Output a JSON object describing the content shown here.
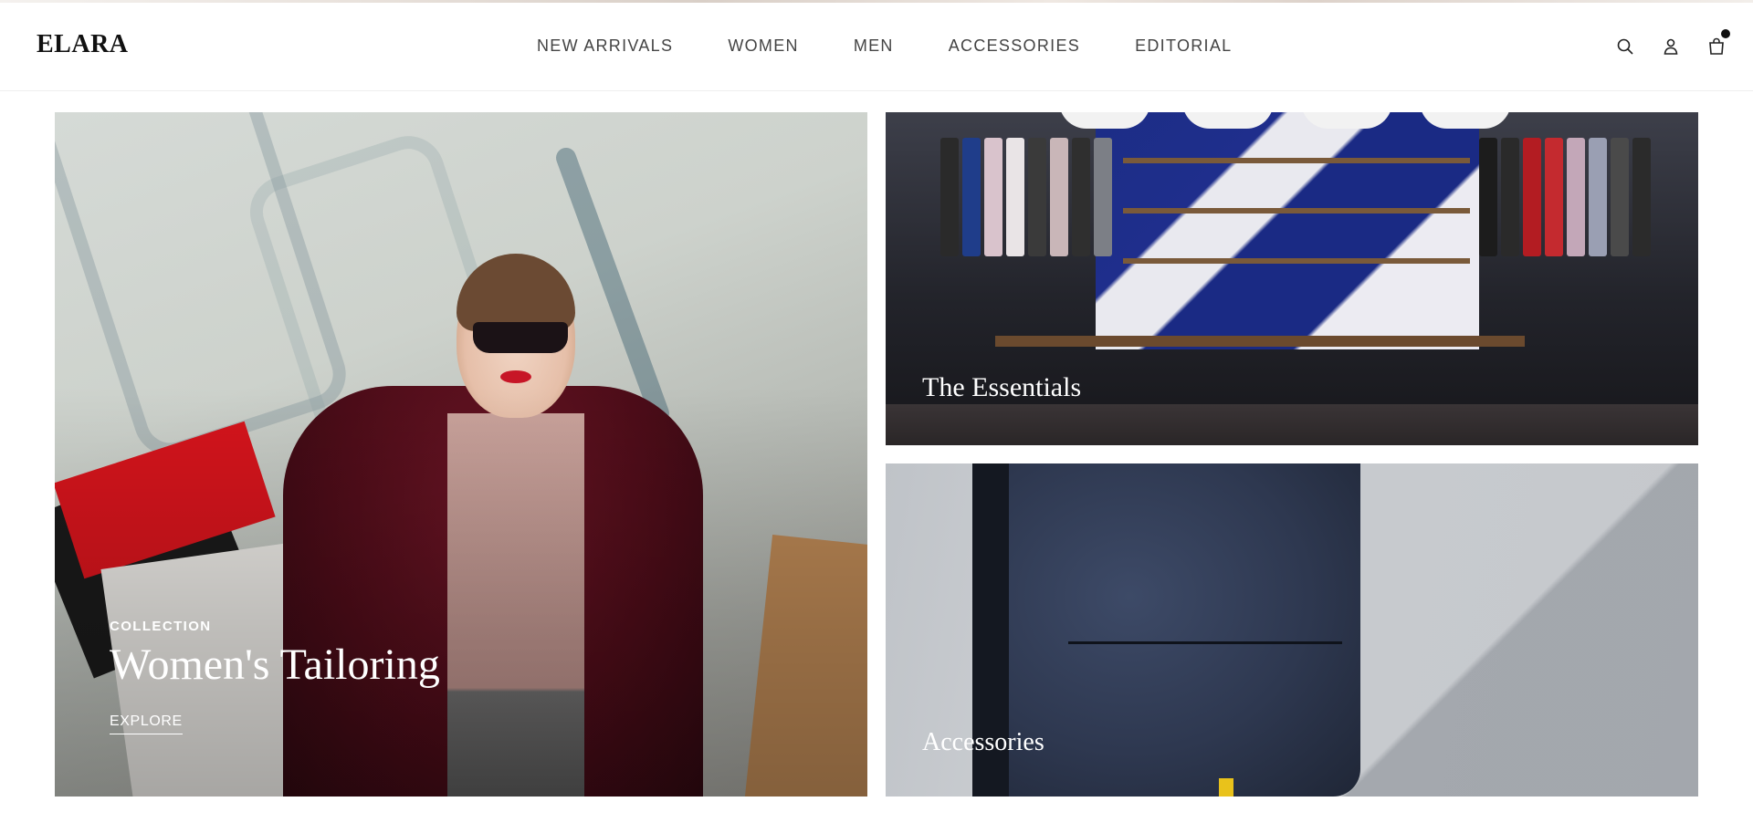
{
  "header": {
    "logo": "ELARA",
    "nav": [
      "NEW ARRIVALS",
      "WOMEN",
      "MEN",
      "ACCESSORIES",
      "EDITORIAL"
    ],
    "icons": [
      "search-icon",
      "user-icon",
      "shopping-bag-icon"
    ],
    "cart_has_items": true
  },
  "hero": {
    "main": {
      "eyebrow": "COLLECTION",
      "title": "Women's Tailoring",
      "cta": "EXPLORE"
    },
    "essentials": {
      "title": "The Essentials"
    },
    "accessories": {
      "title": "Accessories"
    }
  },
  "colors": {
    "text": "#222222",
    "overlay_text": "#ffffff",
    "cart_dot": "#111111"
  }
}
